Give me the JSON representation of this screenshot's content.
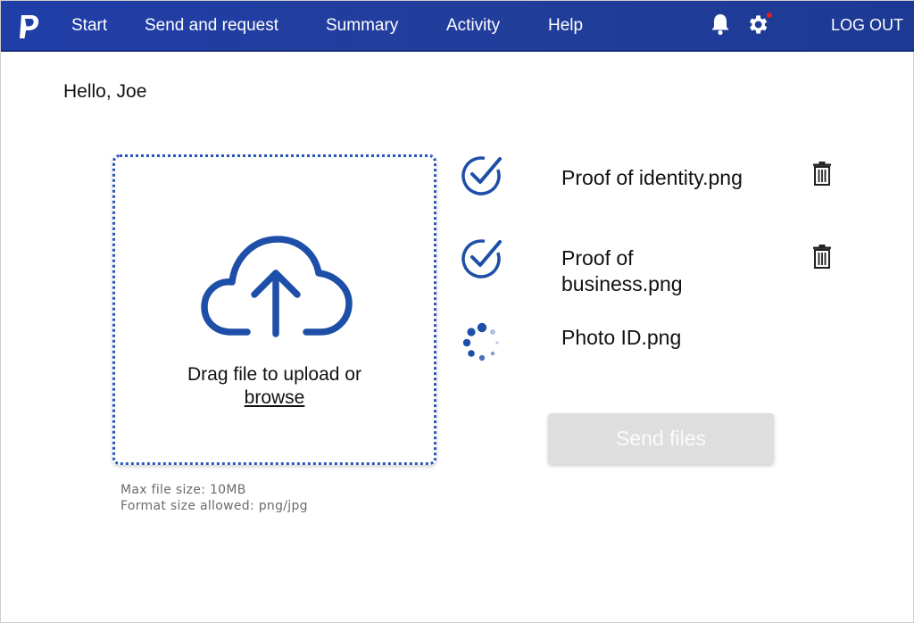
{
  "nav": {
    "items": [
      "Start",
      "Send and request",
      "Summary",
      "Activity",
      "Help"
    ],
    "logout": "LOG OUT",
    "icons": [
      "paypal-logo-icon",
      "bell-icon",
      "gear-icon"
    ],
    "notification_color": "#e02020"
  },
  "greeting": "Hello, Joe",
  "upload": {
    "instruction": "Drag file to upload or",
    "browse_label": "browse",
    "hints": [
      "Max file size: 10MB",
      "Format size allowed: png/jpg"
    ]
  },
  "files": [
    {
      "name": "Proof of identity.png",
      "status": "uploaded"
    },
    {
      "name_lines": [
        "Proof of",
        "business.png"
      ],
      "status": "uploaded"
    },
    {
      "name": "Photo ID.png",
      "status": "uploading"
    }
  ],
  "send_button": "Send files",
  "colors": {
    "brand": "#1f3ea8",
    "accent": "#1e4fa8",
    "disabled": "#dedede"
  }
}
